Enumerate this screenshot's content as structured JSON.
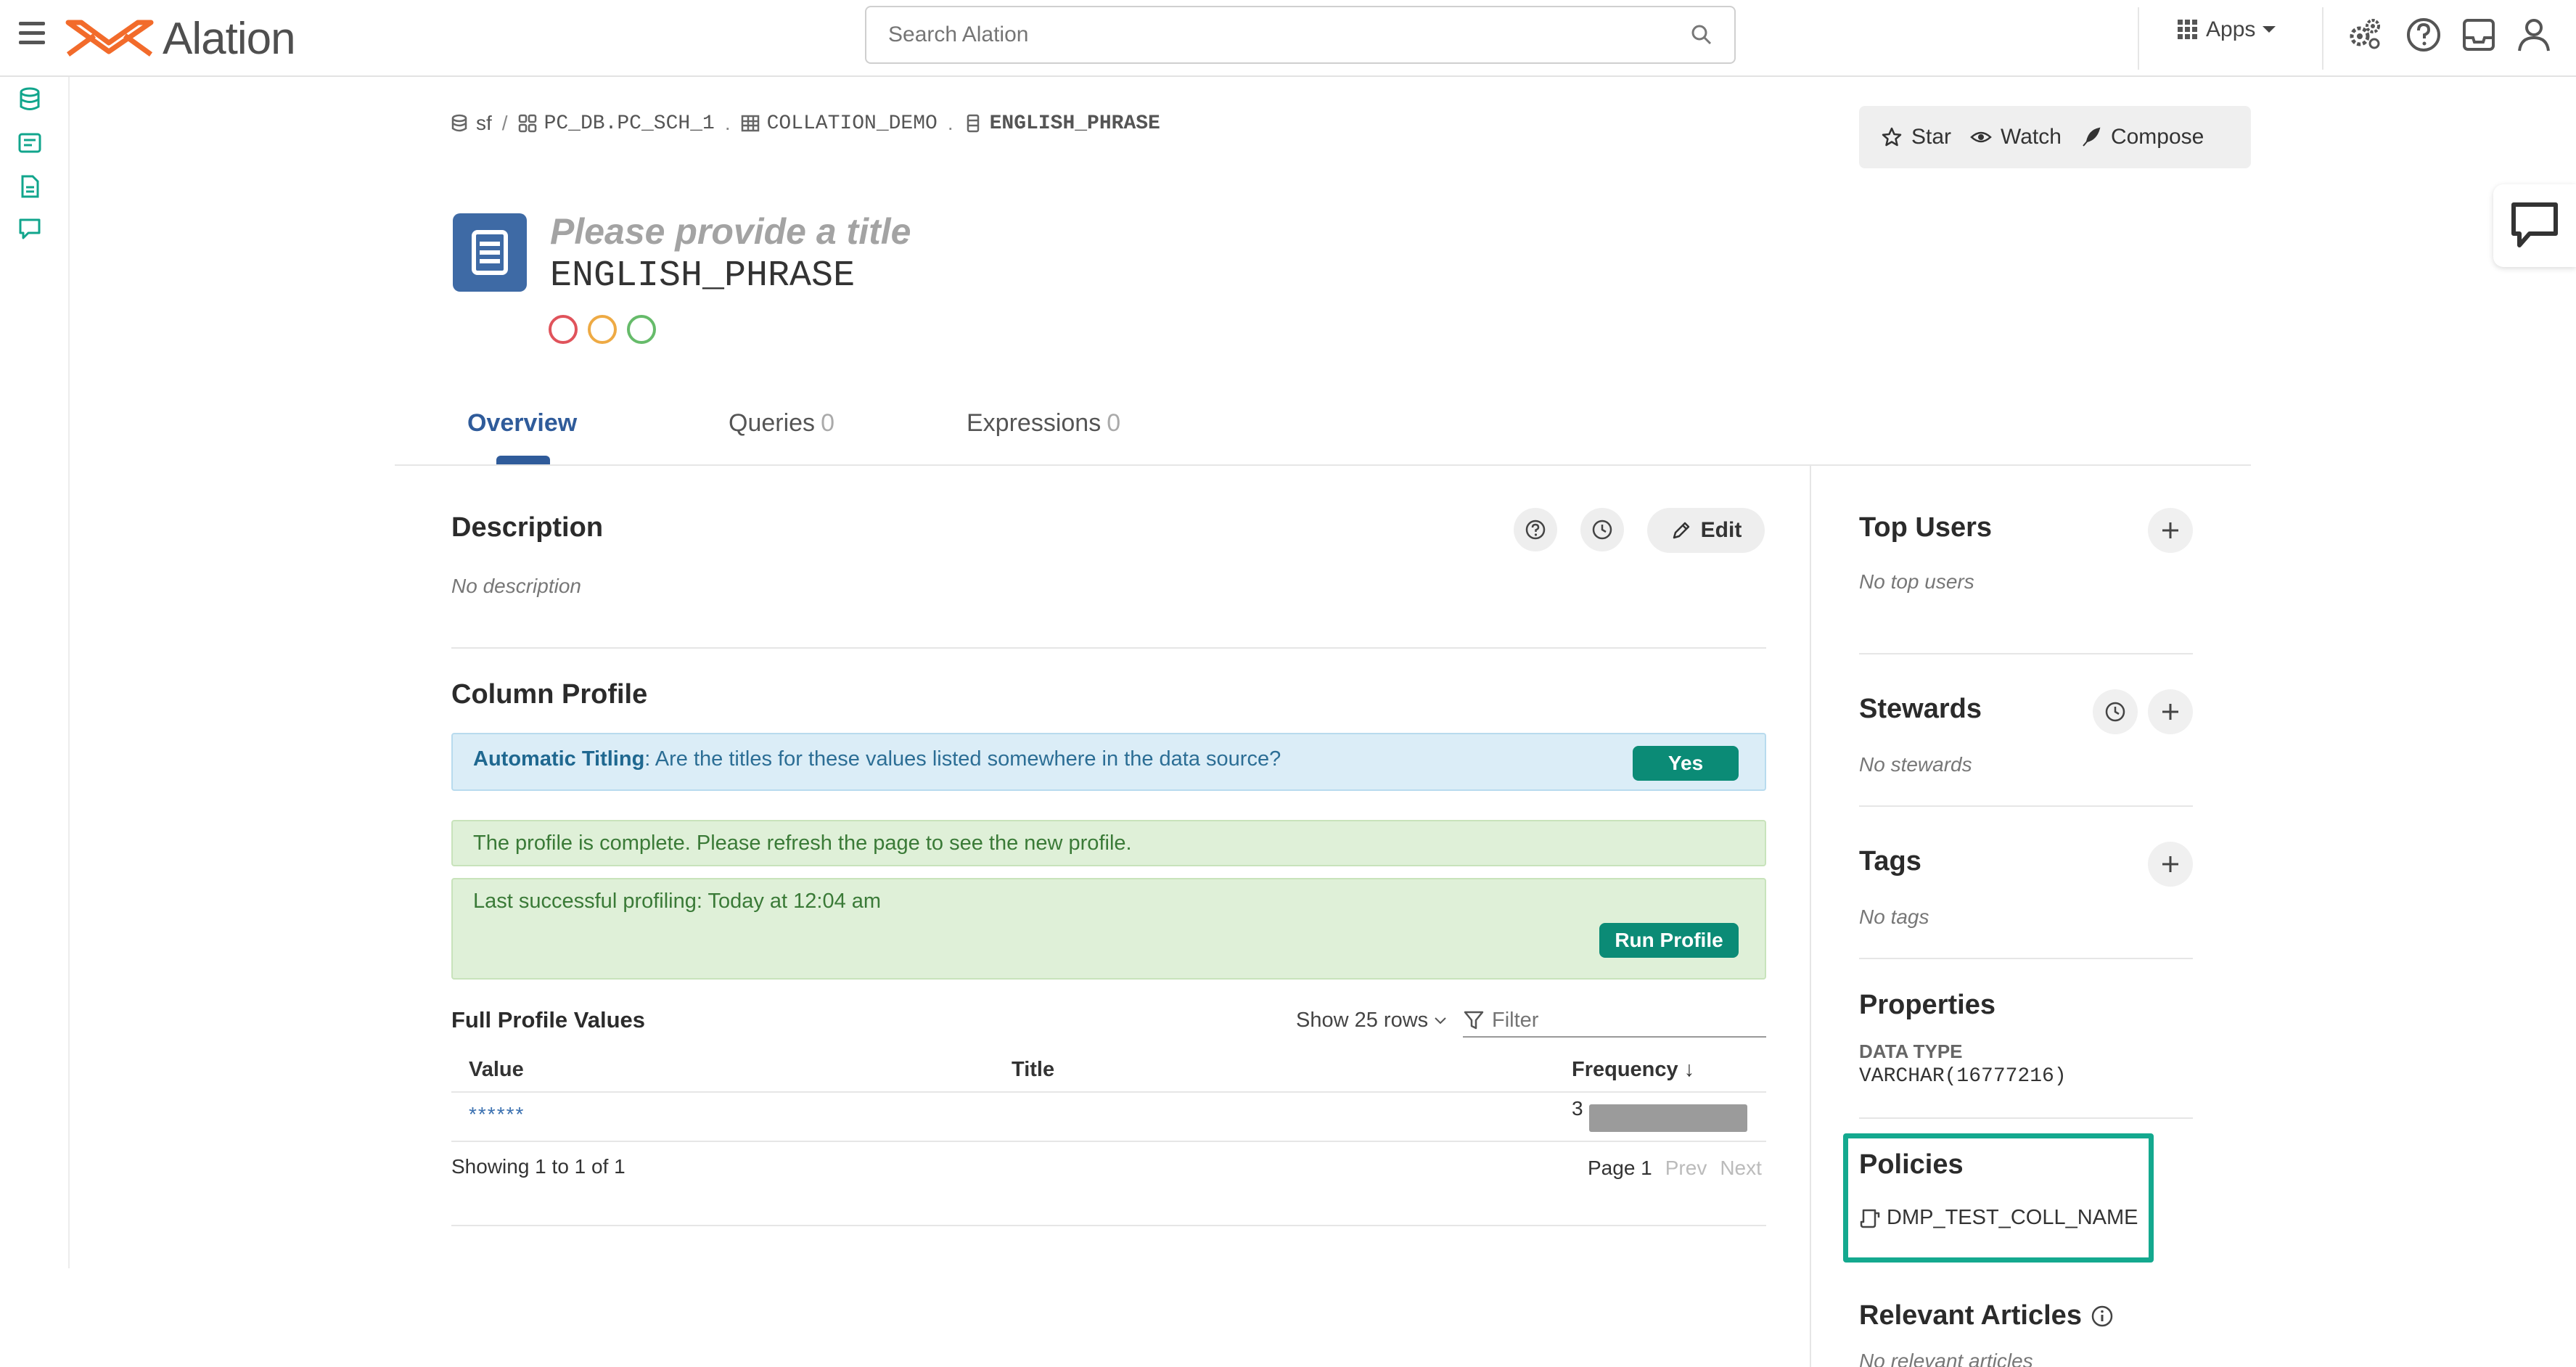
{
  "app": {
    "logo_text": "Alation",
    "search_placeholder": "Search Alation",
    "apps_label": "Apps"
  },
  "breadcrumb": {
    "items": [
      "sf",
      "PC_DB.PC_SCH_1",
      "COLLATION_DEMO",
      "ENGLISH_PHRASE"
    ],
    "separators": [
      "/",
      ".",
      "."
    ]
  },
  "actions": {
    "star": "Star",
    "watch": "Watch",
    "compose": "Compose"
  },
  "header": {
    "title_placeholder": "Please provide a title",
    "name": "ENGLISH_PHRASE",
    "trust_colors": [
      "#e0535b",
      "#eeaa44",
      "#66bb6a"
    ]
  },
  "tabs": [
    {
      "label": "Overview",
      "count": ""
    },
    {
      "label": "Queries",
      "count": "0"
    },
    {
      "label": "Expressions",
      "count": "0"
    }
  ],
  "description": {
    "title": "Description",
    "empty": "No description",
    "edit": "Edit"
  },
  "profile": {
    "title": "Column Profile",
    "auto_title_label": "Automatic Titling",
    "auto_title_question": ": Are the titles for these values listed somewhere in the data source?",
    "yes": "Yes",
    "complete_msg": "The profile is complete. Please refresh the page to see the new profile.",
    "last_success": "Last successful profiling: Today at 12:04 am",
    "run_profile": "Run Profile"
  },
  "values_table": {
    "title": "Full Profile Values",
    "show_rows": "Show 25 rows",
    "filter_placeholder": "Filter",
    "columns": [
      "Value",
      "Title",
      "Frequency"
    ],
    "sort_arrow": "↓",
    "rows": [
      {
        "value": "******",
        "title": "",
        "frequency": "3",
        "frequency_fraction": 1.0
      }
    ],
    "showing": "Showing 1 to 1 of 1",
    "page": "Page 1",
    "prev": "Prev",
    "next": "Next"
  },
  "sidebar": {
    "top_users": {
      "title": "Top Users",
      "empty": "No top users"
    },
    "stewards": {
      "title": "Stewards",
      "empty": "No stewards"
    },
    "tags": {
      "title": "Tags",
      "empty": "No tags"
    },
    "properties": {
      "title": "Properties",
      "data_type_label": "DATA TYPE",
      "data_type_value": "VARCHAR(16777216)"
    },
    "policies": {
      "title": "Policies",
      "item": "DMP_TEST_COLL_NAME"
    },
    "relevant_articles": {
      "title": "Relevant Articles",
      "empty": "No relevant articles"
    }
  },
  "colors": {
    "brand_orange": "#f26b2b",
    "accent_blue": "#2f5b9a",
    "teal": "#0b8b76",
    "policy_highlight": "#14a98f"
  }
}
